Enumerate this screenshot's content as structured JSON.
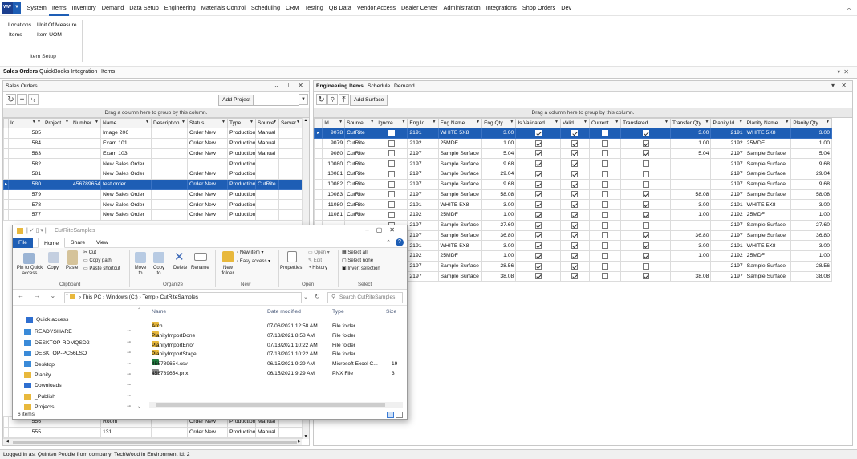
{
  "menu": {
    "items": [
      "System",
      "Items",
      "Inventory",
      "Demand",
      "Data Setup",
      "Engineering",
      "Materials Control",
      "Scheduling",
      "CRM",
      "Testing",
      "QB Data",
      "Vendor Access",
      "Dealer Center",
      "Administration",
      "Integrations",
      "Shop Orders",
      "Dev"
    ],
    "active": "Items"
  },
  "ribbon": {
    "locations": "Locations",
    "unit_of_measure": "Unit Of Measure",
    "items": "Items",
    "item_uom": "Item UOM",
    "group_label": "Item Setup"
  },
  "module_tabs": [
    "Sales Orders",
    "QuickBooks Integration",
    "Items"
  ],
  "sales_orders": {
    "title": "Sales Orders",
    "add_project_label": "Add Project",
    "group_hint": "Drag a column here to group by this column.",
    "columns": [
      "Id",
      "Project",
      "Number",
      "Name",
      "Description",
      "Status",
      "Type",
      "Source",
      "Server"
    ],
    "rows": [
      {
        "id": "585",
        "project": "",
        "number": "",
        "name": "Image 206",
        "description": "",
        "status": "Order New",
        "type": "Production",
        "source": "Manual"
      },
      {
        "id": "584",
        "project": "",
        "number": "",
        "name": "Exam 101",
        "description": "",
        "status": "Order New",
        "type": "Production",
        "source": "Manual"
      },
      {
        "id": "583",
        "project": "",
        "number": "",
        "name": "Exam 103",
        "description": "",
        "status": "Order New",
        "type": "Production",
        "source": "Manual"
      },
      {
        "id": "582",
        "project": "",
        "number": "",
        "name": "New Sales Order",
        "description": "",
        "status": "",
        "type": "Production",
        "source": ""
      },
      {
        "id": "581",
        "project": "",
        "number": "",
        "name": "New Sales Order",
        "description": "",
        "status": "Order New",
        "type": "Production",
        "source": ""
      },
      {
        "id": "580",
        "project": "",
        "number": "456789654",
        "name": "test order",
        "description": "",
        "status": "Order New",
        "type": "Production",
        "source": "CutRite",
        "selected": true
      },
      {
        "id": "579",
        "project": "",
        "number": "",
        "name": "New Sales Order",
        "description": "",
        "status": "Order New",
        "type": "Production",
        "source": ""
      },
      {
        "id": "578",
        "project": "",
        "number": "",
        "name": "New Sales Order",
        "description": "",
        "status": "Order New",
        "type": "Production",
        "source": ""
      },
      {
        "id": "577",
        "project": "",
        "number": "",
        "name": "New Sales Order",
        "description": "",
        "status": "Order New",
        "type": "Production",
        "source": ""
      }
    ],
    "bottom_rows": [
      {
        "id": "556",
        "name": "Room",
        "status": "Order New",
        "type": "Production",
        "source": "Manual"
      },
      {
        "id": "555",
        "name": "131",
        "status": "Order New",
        "type": "Production",
        "source": "Manual"
      }
    ]
  },
  "engineering": {
    "tabs": [
      "Engineering Items",
      "Schedule",
      "Demand"
    ],
    "add_surface_label": "Add Surface",
    "group_hint": "Drag a column here to group by this column.",
    "columns": [
      "Id",
      "Source",
      "Ignore",
      "Eng Id",
      "Eng Name",
      "Eng Qty",
      "Is Validated",
      "Valid",
      "Current",
      "Transfered",
      "Transfer Qty",
      "Planity Id",
      "Planity Name",
      "Planity Qty"
    ],
    "rows": [
      {
        "id": "9078",
        "source": "CutRite",
        "ignore": false,
        "eng_id": "2191",
        "eng_name": "WHITE 5X8",
        "eng_qty": "3.00",
        "validated": true,
        "valid": true,
        "current": false,
        "transfered": true,
        "transfer_qty": "3.00",
        "planity_id": "2191",
        "planity_name": "WHITE 5X8",
        "planity_qty": "3.00",
        "selected": true
      },
      {
        "id": "9079",
        "source": "CutRite",
        "ignore": false,
        "eng_id": "2192",
        "eng_name": "25MDF",
        "eng_qty": "1.00",
        "validated": true,
        "valid": true,
        "current": false,
        "transfered": true,
        "transfer_qty": "1.00",
        "planity_id": "2192",
        "planity_name": "25MDF",
        "planity_qty": "1.00"
      },
      {
        "id": "9080",
        "source": "CutRite",
        "ignore": false,
        "eng_id": "2197",
        "eng_name": "Sample Surface",
        "eng_qty": "5.04",
        "validated": true,
        "valid": true,
        "current": false,
        "transfered": true,
        "transfer_qty": "5.04",
        "planity_id": "2197",
        "planity_name": "Sample Surface",
        "planity_qty": "5.04"
      },
      {
        "id": "10080",
        "source": "CutRite",
        "ignore": false,
        "eng_id": "2197",
        "eng_name": "Sample Surface",
        "eng_qty": "9.68",
        "validated": true,
        "valid": true,
        "current": false,
        "transfered": false,
        "transfer_qty": "",
        "planity_id": "2197",
        "planity_name": "Sample Surface",
        "planity_qty": "9.68"
      },
      {
        "id": "10081",
        "source": "CutRite",
        "ignore": false,
        "eng_id": "2197",
        "eng_name": "Sample Surface",
        "eng_qty": "29.04",
        "validated": true,
        "valid": true,
        "current": false,
        "transfered": false,
        "transfer_qty": "",
        "planity_id": "2197",
        "planity_name": "Sample Surface",
        "planity_qty": "29.04"
      },
      {
        "id": "10082",
        "source": "CutRite",
        "ignore": false,
        "eng_id": "2197",
        "eng_name": "Sample Surface",
        "eng_qty": "9.68",
        "validated": true,
        "valid": true,
        "current": false,
        "transfered": false,
        "transfer_qty": "",
        "planity_id": "2197",
        "planity_name": "Sample Surface",
        "planity_qty": "9.68"
      },
      {
        "id": "10083",
        "source": "CutRite",
        "ignore": false,
        "eng_id": "2197",
        "eng_name": "Sample Surface",
        "eng_qty": "58.08",
        "validated": true,
        "valid": true,
        "current": false,
        "transfered": true,
        "transfer_qty": "58.08",
        "planity_id": "2197",
        "planity_name": "Sample Surface",
        "planity_qty": "58.08"
      },
      {
        "id": "11080",
        "source": "CutRite",
        "ignore": false,
        "eng_id": "2191",
        "eng_name": "WHITE 5X8",
        "eng_qty": "3.00",
        "validated": true,
        "valid": true,
        "current": false,
        "transfered": true,
        "transfer_qty": "3.00",
        "planity_id": "2191",
        "planity_name": "WHITE 5X8",
        "planity_qty": "3.00"
      },
      {
        "id": "11081",
        "source": "CutRite",
        "ignore": false,
        "eng_id": "2192",
        "eng_name": "25MDF",
        "eng_qty": "1.00",
        "validated": true,
        "valid": true,
        "current": false,
        "transfered": true,
        "transfer_qty": "1.00",
        "planity_id": "2192",
        "planity_name": "25MDF",
        "planity_qty": "1.00"
      },
      {
        "id": "",
        "source": "",
        "ignore": false,
        "eng_id": "2197",
        "eng_name": "Sample Surface",
        "eng_qty": "27.60",
        "validated": true,
        "valid": true,
        "current": false,
        "transfered": false,
        "transfer_qty": "",
        "planity_id": "2197",
        "planity_name": "Sample Surface",
        "planity_qty": "27.60"
      },
      {
        "id": "",
        "source": "",
        "ignore": false,
        "eng_id": "2197",
        "eng_name": "Sample Surface",
        "eng_qty": "36.80",
        "validated": true,
        "valid": true,
        "current": false,
        "transfered": true,
        "transfer_qty": "36.80",
        "planity_id": "2197",
        "planity_name": "Sample Surface",
        "planity_qty": "36.80"
      },
      {
        "id": "",
        "source": "",
        "ignore": false,
        "eng_id": "2191",
        "eng_name": "WHITE 5X8",
        "eng_qty": "3.00",
        "validated": true,
        "valid": true,
        "current": false,
        "transfered": true,
        "transfer_qty": "3.00",
        "planity_id": "2191",
        "planity_name": "WHITE 5X8",
        "planity_qty": "3.00"
      },
      {
        "id": "",
        "source": "",
        "ignore": false,
        "eng_id": "2192",
        "eng_name": "25MDF",
        "eng_qty": "1.00",
        "validated": true,
        "valid": true,
        "current": false,
        "transfered": true,
        "transfer_qty": "1.00",
        "planity_id": "2192",
        "planity_name": "25MDF",
        "planity_qty": "1.00"
      },
      {
        "id": "",
        "source": "",
        "ignore": false,
        "eng_id": "2197",
        "eng_name": "Sample Surface",
        "eng_qty": "28.56",
        "validated": true,
        "valid": true,
        "current": false,
        "transfered": false,
        "transfer_qty": "",
        "planity_id": "2197",
        "planity_name": "Sample Surface",
        "planity_qty": "28.56"
      },
      {
        "id": "",
        "source": "",
        "ignore": false,
        "eng_id": "2197",
        "eng_name": "Sample Surface",
        "eng_qty": "38.08",
        "validated": true,
        "valid": true,
        "current": false,
        "transfered": true,
        "transfer_qty": "38.08",
        "planity_id": "2197",
        "planity_name": "Sample Surface",
        "planity_qty": "38.08"
      }
    ]
  },
  "explorer": {
    "title": "CutRiteSamples",
    "tabs": {
      "file": "File",
      "home": "Home",
      "share": "Share",
      "view": "View"
    },
    "ribbon": {
      "pin": "Pin to Quick access",
      "copy": "Copy",
      "paste": "Paste",
      "cut": "Cut",
      "copy_path": "Copy path",
      "paste_shortcut": "Paste shortcut",
      "move_to": "Move to",
      "copy_to": "Copy to",
      "delete": "Delete",
      "rename": "Rename",
      "new_folder": "New folder",
      "new_item": "New item",
      "easy_access": "Easy access",
      "properties": "Properties",
      "open": "Open",
      "edit": "Edit",
      "history": "History",
      "select_all": "Select all",
      "select_none": "Select none",
      "invert_selection": "Invert selection",
      "groups": {
        "clipboard": "Clipboard",
        "organize": "Organize",
        "new": "New",
        "open": "Open",
        "select": "Select"
      }
    },
    "path": [
      "This PC",
      "Windows (C:)",
      "Temp",
      "CutRiteSamples"
    ],
    "search_placeholder": "Search CutRiteSamples",
    "nav": [
      {
        "label": "Quick access",
        "icon": "star-icon"
      },
      {
        "label": "READYSHARE",
        "icon": "monitor-icon"
      },
      {
        "label": "DESKTOP-RDMQSD2",
        "icon": "monitor-icon"
      },
      {
        "label": "DESKTOP-PC56LSO",
        "icon": "monitor-icon"
      },
      {
        "label": "Desktop",
        "icon": "desktop-folder-icon"
      },
      {
        "label": "Planity",
        "icon": "folder-icon"
      },
      {
        "label": "Downloads",
        "icon": "download-icon"
      },
      {
        "label": "_Publish",
        "icon": "folder-icon"
      },
      {
        "label": "Projects",
        "icon": "folder-icon"
      }
    ],
    "columns": {
      "name": "Name",
      "date": "Date modified",
      "type": "Type",
      "size": "Size"
    },
    "files": [
      {
        "name": "Arch",
        "date": "07/06/2021 12:58 AM",
        "type": "File folder",
        "size": "",
        "icon": "folder-icon"
      },
      {
        "name": "PlanityImportDone",
        "date": "07/13/2021 8:58 AM",
        "type": "File folder",
        "size": "",
        "icon": "folder-icon"
      },
      {
        "name": "PlanityImportError",
        "date": "07/13/2021 10:22 AM",
        "type": "File folder",
        "size": "",
        "icon": "folder-icon"
      },
      {
        "name": "PlanityImportStage",
        "date": "07/13/2021 10:22 AM",
        "type": "File folder",
        "size": "",
        "icon": "folder-icon"
      },
      {
        "name": "456789654.csv",
        "date": "06/15/2021 9:29 AM",
        "type": "Microsoft Excel C...",
        "size": "19",
        "icon": "excel-icon"
      },
      {
        "name": "456789654.pnx",
        "date": "06/15/2021 9:29 AM",
        "type": "PNX File",
        "size": "3",
        "icon": "file-icon"
      }
    ],
    "item_count": "6 items"
  },
  "status_bar": "Logged in as: Quinten Peddie  from company: TechWood in Environment Id: 2",
  "colors": {
    "accent": "#1e5eb5",
    "selection": "#1e5eb5",
    "folder": "#e8b83c"
  }
}
